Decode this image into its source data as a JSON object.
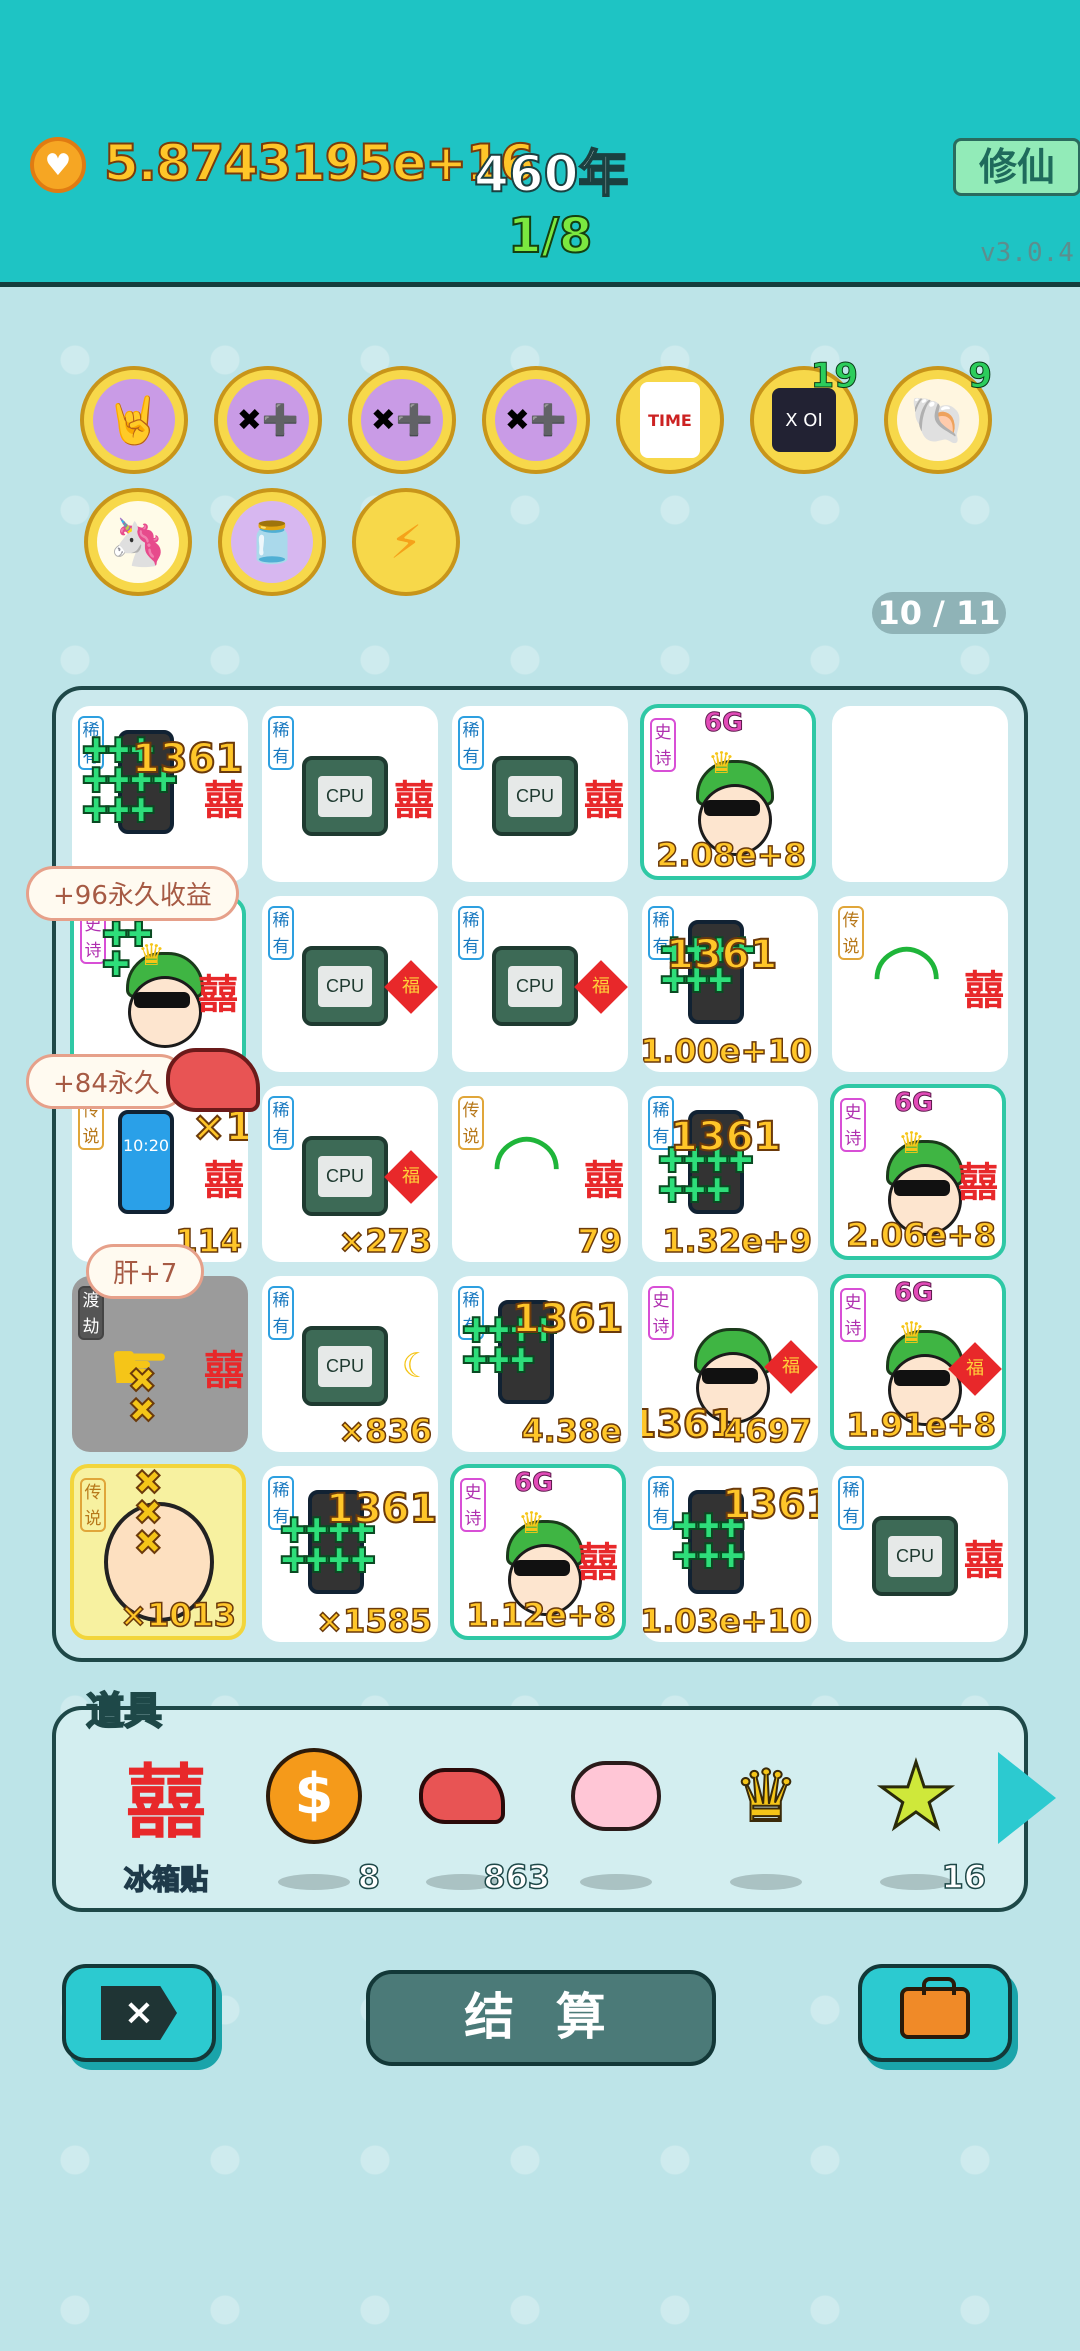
{
  "header": {
    "coins": "5.8743195e+16",
    "years": "460年",
    "progress": "1/8",
    "xiuxian_label": "修仙",
    "version": "v3.0.4"
  },
  "buffs": [
    {
      "icon": "rock-hand-icon",
      "count": ""
    },
    {
      "icon": "math-head-icon",
      "count": ""
    },
    {
      "icon": "math-head-icon",
      "count": ""
    },
    {
      "icon": "math-head-icon",
      "count": ""
    },
    {
      "icon": "time-magazine-icon",
      "count": ""
    },
    {
      "icon": "chip-icon",
      "count": "19"
    },
    {
      "icon": "shell-icon",
      "count": "9"
    },
    {
      "icon": "unicorn-icon",
      "count": ""
    },
    {
      "icon": "jar-icon",
      "count": ""
    },
    {
      "icon": "lightning-icon",
      "count": ""
    }
  ],
  "slot_count": "10 / 11",
  "grid": {
    "r0": [
      {
        "tag": "稀有",
        "kind": "phone",
        "float": "1361"
      },
      {
        "tag": "稀有",
        "kind": "cpu",
        "deco": "囍"
      },
      {
        "tag": "稀有",
        "kind": "cpu",
        "deco": "囍"
      },
      {
        "tag": "史诗",
        "kind": "hero",
        "value": "2.08e+8"
      },
      {
        "tag": "",
        "kind": "empty"
      }
    ],
    "r1": [
      {
        "tag": "史诗",
        "kind": "hero"
      },
      {
        "tag": "稀有",
        "kind": "cpu",
        "deco": "福"
      },
      {
        "tag": "稀有",
        "kind": "cpu",
        "deco": "福"
      },
      {
        "tag": "稀有",
        "kind": "phone",
        "value": "1.00e+10",
        "float": "1361"
      },
      {
        "tag": "传说",
        "kind": "wifi",
        "deco": "囍"
      }
    ],
    "r2": [
      {
        "tag": "传说",
        "kind": "phone2",
        "value": "114",
        "float": "×14"
      },
      {
        "tag": "稀有",
        "kind": "cpu",
        "deco": "福",
        "value": "×273"
      },
      {
        "tag": "传说",
        "kind": "wifi",
        "deco": "囍",
        "value": "79"
      },
      {
        "tag": "稀有",
        "kind": "phone",
        "value": "1.32e+9",
        "float": "1361"
      },
      {
        "tag": "史诗",
        "kind": "hero",
        "value": "2.06e+8"
      }
    ],
    "r3": [
      {
        "tag": "渡劫",
        "kind": "pointer",
        "deco": "囍"
      },
      {
        "tag": "稀有",
        "kind": "cpu",
        "deco": "moon",
        "value": "×836"
      },
      {
        "tag": "稀有",
        "kind": "phone",
        "value": "4.38e",
        "float": "1361"
      },
      {
        "tag": "史诗",
        "kind": "hero",
        "deco": "福",
        "value": "4697",
        "float": "1361"
      },
      {
        "tag": "史诗",
        "kind": "hero",
        "deco": "福",
        "value": "1.91e+8"
      }
    ],
    "r4": [
      {
        "tag": "传说",
        "kind": "bald",
        "value": "×1013"
      },
      {
        "tag": "稀有",
        "kind": "phone",
        "value": "×1585",
        "float": "1361"
      },
      {
        "tag": "史诗",
        "kind": "hero",
        "deco": "囍",
        "value": "1.12e+8"
      },
      {
        "tag": "稀有",
        "kind": "phone",
        "value": "1.03e+10",
        "float": "1361"
      },
      {
        "tag": "稀有",
        "kind": "cpu",
        "deco": "囍"
      }
    ]
  },
  "bubbles": {
    "b1": "+96永久收益",
    "b2": "+84永久",
    "b3": "肝+7"
  },
  "props": {
    "title": "道具",
    "items": [
      {
        "icon": "xi-sticker-icon",
        "label": "冰箱贴",
        "count": ""
      },
      {
        "icon": "dollar-coin-icon",
        "label": "",
        "count": "8"
      },
      {
        "icon": "liver-icon",
        "label": "",
        "count": "863"
      },
      {
        "icon": "piggy-bank-icon",
        "label": "",
        "count": ""
      },
      {
        "icon": "crown-icon",
        "label": "",
        "count": ""
      },
      {
        "icon": "star-icon",
        "label": "",
        "count": "16"
      }
    ]
  },
  "buttons": {
    "close_glyph": "×",
    "settle": "结 算"
  },
  "cell_texts": {
    "cpu": "CPU",
    "xi": "囍",
    "fu": "福",
    "g6": "6G",
    "phone_time": "10:20"
  },
  "colors": {
    "topbar": "#1ec4c4",
    "coin_text": "#ffc629",
    "progress_text": "#7be840",
    "accent": "#2ccad0"
  }
}
